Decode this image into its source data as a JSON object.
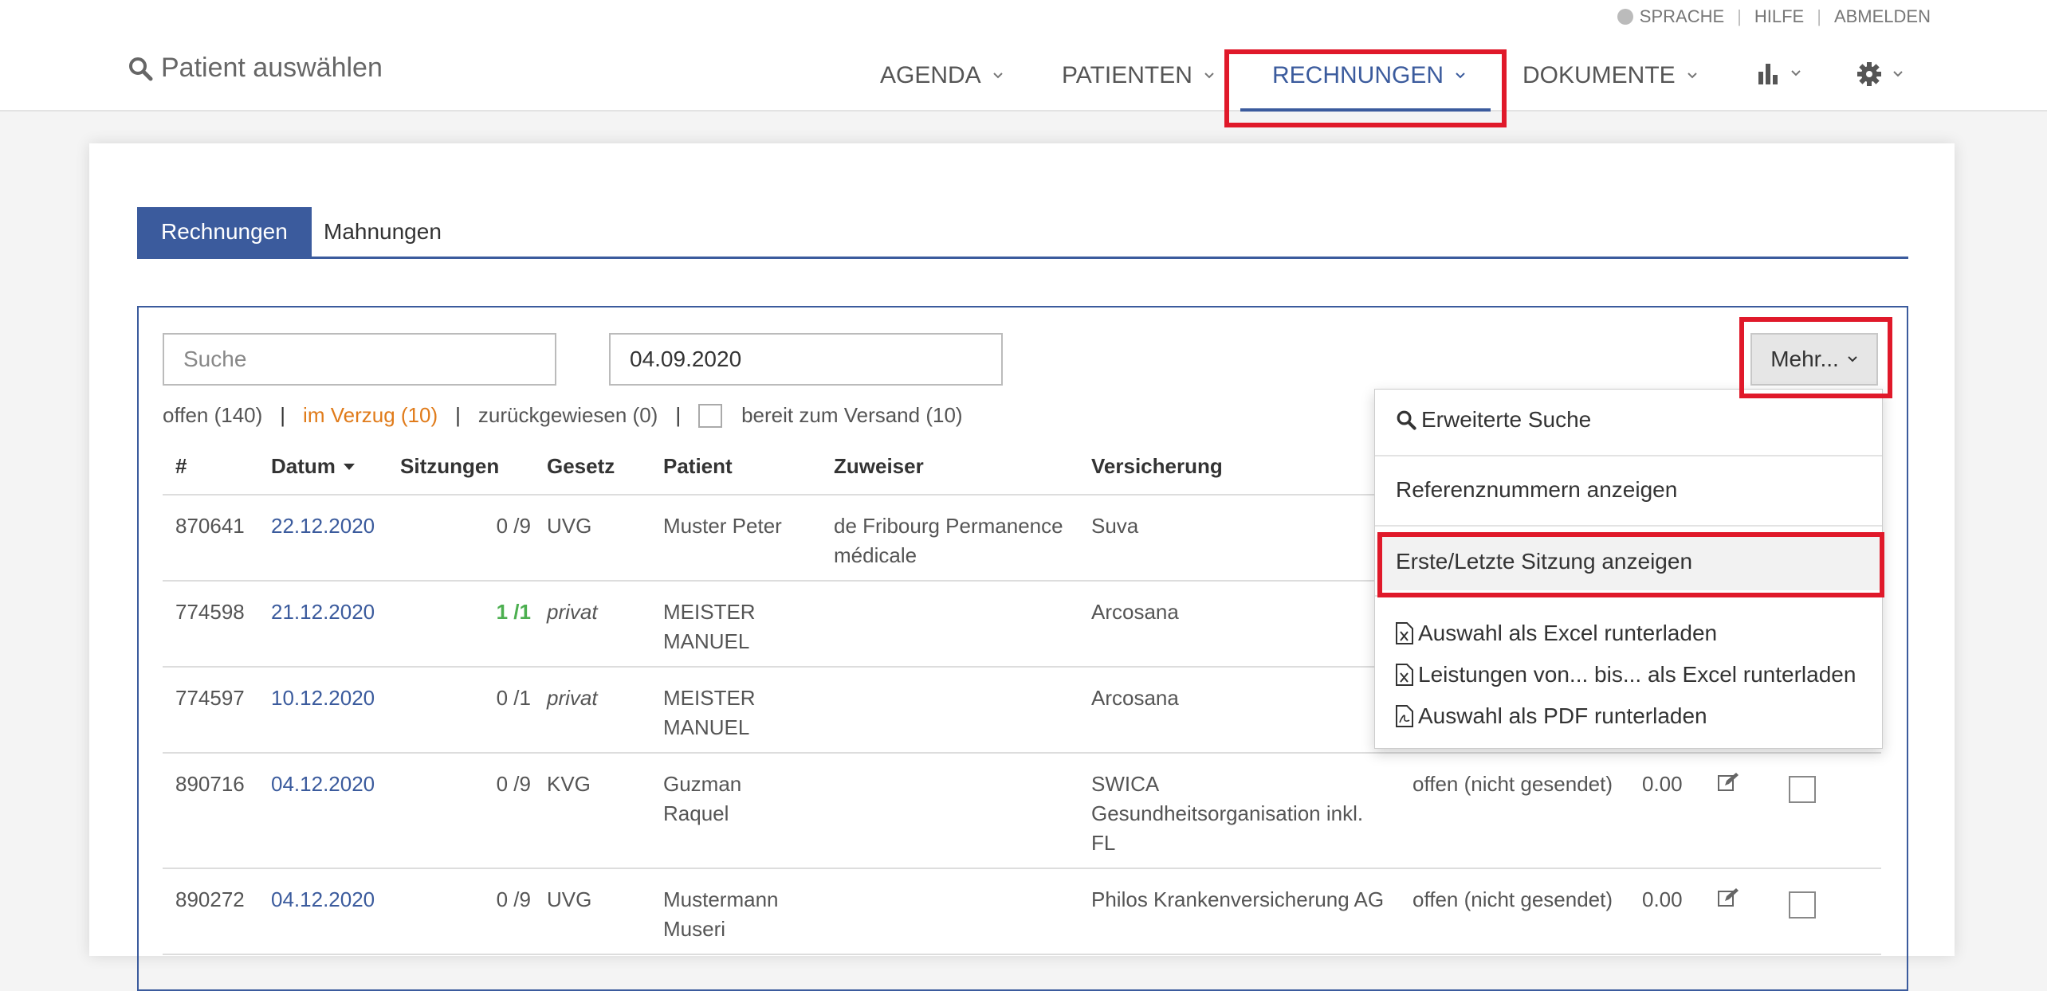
{
  "header": {
    "util_links": [
      "SPRACHE",
      "HILFE",
      "ABMELDEN"
    ],
    "patient_select_label": "Patient auswählen",
    "nav": [
      {
        "label": "AGENDA"
      },
      {
        "label": "PATIENTEN"
      },
      {
        "label": "RECHNUNGEN",
        "active": true
      },
      {
        "label": "DOKUMENTE"
      },
      {
        "label": "",
        "icon": "bar-chart-icon"
      },
      {
        "label": "",
        "icon": "gear-icon"
      }
    ]
  },
  "tabs": [
    {
      "label": "Rechnungen",
      "active": true
    },
    {
      "label": "Mahnungen"
    }
  ],
  "search": {
    "placeholder": "Suche",
    "value": ""
  },
  "date_filter": {
    "value": "04.09.2020"
  },
  "more_button": {
    "label": "Mehr..."
  },
  "status_filters": {
    "open": "offen (140)",
    "overdue": "im Verzug (10)",
    "rejected": "zurückgewiesen (0)",
    "ready": "bereit zum Versand (10)",
    "separator": "|"
  },
  "table": {
    "headers": [
      "#",
      "Datum",
      "Sitzungen",
      "Gesetz",
      "Patient",
      "Zuweiser",
      "Versicherung"
    ],
    "rows": [
      {
        "id": "870641",
        "date": "22.12.2020",
        "sessions": "0 /9",
        "law": "UVG",
        "patient": [
          "Muster Peter"
        ],
        "referrer": [
          "de Fribourg Permanence",
          "médicale"
        ],
        "insurance": [
          "Suva"
        ],
        "status": "",
        "amount": ""
      },
      {
        "id": "774598",
        "date": "21.12.2020",
        "sessions": "1 /1",
        "law": "privat",
        "patient": [
          "MEISTER",
          "MANUEL"
        ],
        "referrer": [],
        "insurance": [
          "Arcosana"
        ],
        "status": "",
        "amount": ""
      },
      {
        "id": "774597",
        "date": "10.12.2020",
        "sessions": "0 /1",
        "law": "privat",
        "patient": [
          "MEISTER",
          "MANUEL"
        ],
        "referrer": [],
        "insurance": [
          "Arcosana"
        ],
        "status": "",
        "amount": ""
      },
      {
        "id": "890716",
        "date": "04.12.2020",
        "sessions": "0 /9",
        "law": "KVG",
        "patient": [
          "Guzman",
          "Raquel"
        ],
        "referrer": [],
        "insurance": [
          "SWICA",
          "Gesundheitsorganisation inkl.",
          "FL"
        ],
        "status": "offen (nicht gesendet)",
        "amount": "0.00"
      },
      {
        "id": "890272",
        "date": "04.12.2020",
        "sessions": "0 /9",
        "law": "UVG",
        "patient": [
          "Mustermann",
          "Museri"
        ],
        "referrer": [],
        "insurance": [
          "Philos Krankenversicherung AG"
        ],
        "status": "offen (nicht gesendet)",
        "amount": "0.00"
      }
    ]
  },
  "dropdown": {
    "items": [
      {
        "label": "Erweiterte Suche",
        "icon": "search-icon"
      },
      {
        "label": "Referenznummern anzeigen"
      },
      {
        "label": "Erste/Letzte Sitzung anzeigen",
        "highlighted": true
      },
      {
        "label": "Auswahl als Excel runterladen",
        "icon": "excel-file-icon"
      },
      {
        "label": "Leistungen von... bis... als Excel runterladen",
        "icon": "excel-file-icon"
      },
      {
        "label": "Auswahl als PDF runterladen",
        "icon": "pdf-file-icon"
      }
    ]
  },
  "colors": {
    "accent": "#3b5b9d",
    "highlight_box": "#e0192a",
    "overdue": "#e07b1a",
    "paid": "#4caf50"
  }
}
